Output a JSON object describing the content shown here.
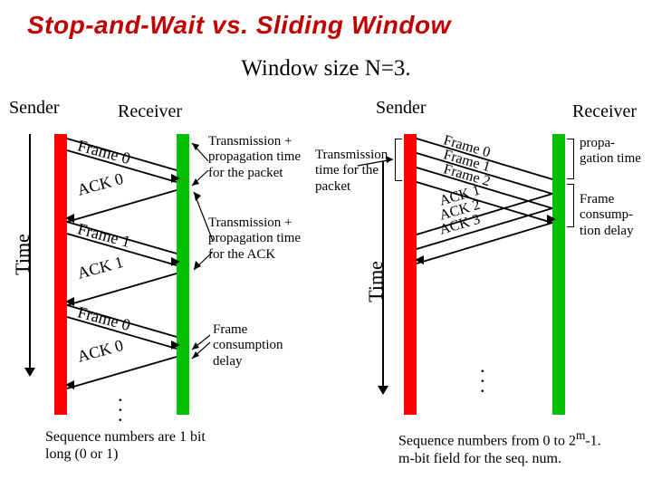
{
  "title": "Stop-and-Wait vs. Sliding Window",
  "subtitle": "Window size N=3.",
  "labels": {
    "sender": "Sender",
    "receiver": "Receiver",
    "time": "Time"
  },
  "left": {
    "messages": {
      "f0": "Frame 0",
      "a0": "ACK 0",
      "f1": "Frame 1",
      "a1": "ACK 1",
      "f0b": "Frame 0",
      "a0b": "ACK 0"
    },
    "ann1": "Transmission + propagation time for the packet",
    "ann2": "Transmission + propagation time for the ACK",
    "ann3": "Frame consumption delay",
    "footnote": "Sequence numbers are 1 bit long (0 or 1)"
  },
  "right": {
    "messages": {
      "f0": "Frame 0",
      "f1": "Frame 1",
      "f2": "Frame 2",
      "a1": "ACK 1",
      "a2": "ACK 2",
      "a3": "ACK 3"
    },
    "ann1": "Transmission time for the packet",
    "ann2": "propa-\ngation time",
    "ann3": "Frame consump-\ntion delay",
    "footnote_a": "Sequence numbers from 0 to 2",
    "footnote_sup": "m",
    "footnote_b": "-1.",
    "footnote_c": "m-bit field for the seq. num."
  }
}
